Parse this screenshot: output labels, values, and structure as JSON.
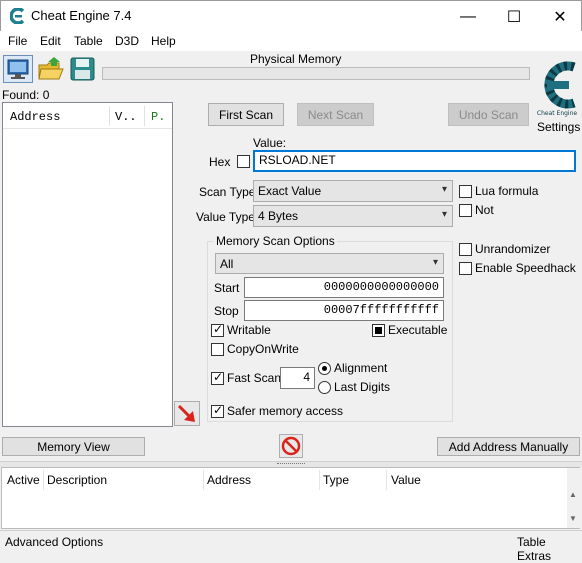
{
  "window": {
    "title": "Cheat Engine 7.4",
    "minimize": "—",
    "maximize": "☐",
    "close": "✕"
  },
  "menu": [
    "File",
    "Edit",
    "Table",
    "D3D",
    "Help"
  ],
  "process_label": "Physical Memory",
  "found": "Found: 0",
  "results_headers": [
    "Address",
    "V..",
    "P."
  ],
  "buttons": {
    "first_scan": "First Scan",
    "next_scan": "Next Scan",
    "undo_scan": "Undo Scan",
    "memory_view": "Memory View",
    "add_address": "Add Address Manually"
  },
  "settings_label": "Settings",
  "value": {
    "label": "Value:",
    "hex_label": "Hex",
    "text": "RSLOAD.NET"
  },
  "scan_type": {
    "label": "Scan Type",
    "selected": "Exact Value"
  },
  "value_type": {
    "label": "Value Type",
    "selected": "4 Bytes"
  },
  "right_options": {
    "lua_formula": "Lua formula",
    "not": "Not",
    "unrandomizer": "Unrandomizer",
    "speedhack": "Enable Speedhack"
  },
  "memory_options": {
    "title": "Memory Scan Options",
    "region": "All",
    "start_label": "Start",
    "start": "0000000000000000",
    "stop_label": "Stop",
    "stop": "00007fffffffffff",
    "writable": "Writable",
    "executable": "Executable",
    "copy_on_write": "CopyOnWrite",
    "fast_scan": "Fast Scan",
    "fast_scan_value": "4",
    "alignment": "Alignment",
    "last_digits": "Last Digits",
    "safer_memory": "Safer memory access"
  },
  "table_headers": [
    "Active",
    "Description",
    "Address",
    "Type",
    "Value"
  ],
  "footer": {
    "advanced": "Advanced Options",
    "extras": "Table Extras"
  },
  "colors": {
    "accent": "#0078d7",
    "logo": "#1e7f8f",
    "arrow": "#d9241c"
  }
}
